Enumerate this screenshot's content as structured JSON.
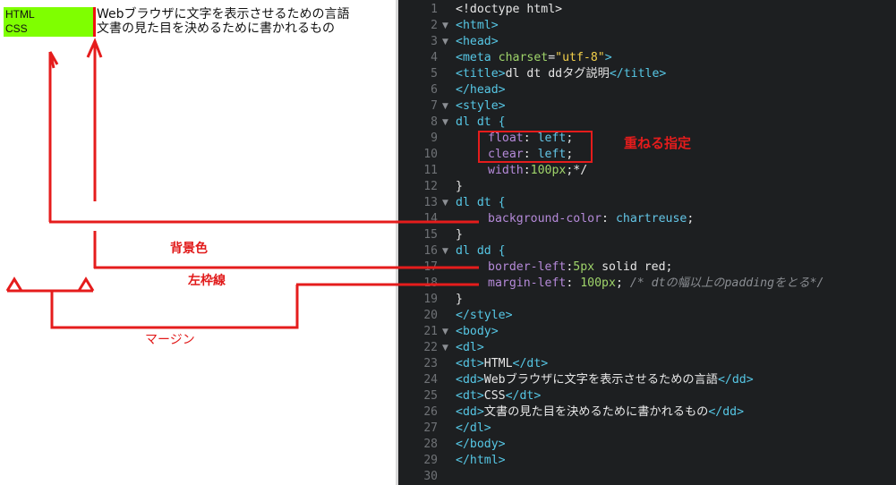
{
  "preview": {
    "rows": [
      {
        "dt": "HTML",
        "dd": "Webブラウザに文字を表示させるための言語"
      },
      {
        "dt": "CSS",
        "dd": "文書の見た目を決めるために書かれるもの"
      }
    ],
    "dt_background": "#7fff00",
    "dd_border_color": "#ff0000"
  },
  "annotations": {
    "background_label": "背景色",
    "border_label": "左枠線",
    "margin_label": "マージン",
    "overlap_label": "重ねる指定",
    "color": "#e51c1c"
  },
  "editor": {
    "lines": [
      {
        "n": "1",
        "fold": ""
      },
      {
        "n": "2",
        "fold": "▼"
      },
      {
        "n": "3",
        "fold": "▼"
      },
      {
        "n": "4",
        "fold": ""
      },
      {
        "n": "5",
        "fold": ""
      },
      {
        "n": "6",
        "fold": ""
      },
      {
        "n": "7",
        "fold": "▼"
      },
      {
        "n": "8",
        "fold": "▼"
      },
      {
        "n": "9",
        "fold": ""
      },
      {
        "n": "10",
        "fold": ""
      },
      {
        "n": "11",
        "fold": ""
      },
      {
        "n": "12",
        "fold": ""
      },
      {
        "n": "13",
        "fold": "▼"
      },
      {
        "n": "14",
        "fold": ""
      },
      {
        "n": "15",
        "fold": ""
      },
      {
        "n": "16",
        "fold": "▼"
      },
      {
        "n": "17",
        "fold": ""
      },
      {
        "n": "18",
        "fold": ""
      },
      {
        "n": "19",
        "fold": ""
      },
      {
        "n": "20",
        "fold": ""
      },
      {
        "n": "21",
        "fold": "▼"
      },
      {
        "n": "22",
        "fold": "▼"
      },
      {
        "n": "23",
        "fold": ""
      },
      {
        "n": "24",
        "fold": ""
      },
      {
        "n": "25",
        "fold": ""
      },
      {
        "n": "26",
        "fold": ""
      },
      {
        "n": "27",
        "fold": ""
      },
      {
        "n": "28",
        "fold": ""
      },
      {
        "n": "29",
        "fold": ""
      },
      {
        "n": "30",
        "fold": ""
      }
    ],
    "code": {
      "l1": "<!doctype html>",
      "l2": "<html>",
      "l3": "<head>",
      "l4_tag": "<meta ",
      "l4_attr": "charset",
      "l4_eq": "=",
      "l4_str": "\"utf-8\"",
      "l4_end": ">",
      "l5_open": "<title>",
      "l5_text": "dl dt ddタグ説明",
      "l5_close": "</title>",
      "l6": "</head>",
      "l7": "<style>",
      "l8": "dl dt {",
      "l9_prop": "float",
      "l9_colon": ": ",
      "l9_val": "left",
      "l9_end": ";",
      "l10_prop": "clear",
      "l10_colon": ": ",
      "l10_val": "left",
      "l10_end": ";",
      "l11_prop": "width",
      "l11_colon": ":",
      "l11_num": "100px",
      "l11_end": ";*/",
      "l12": "}",
      "l13": "dl dt {",
      "l14_prop": "background-color",
      "l14_colon": ": ",
      "l14_val": "chartreuse",
      "l14_end": ";",
      "l15": "}",
      "l16": "dl dd {",
      "l17_prop": "border-left",
      "l17_colon": ":",
      "l17_num": "5px",
      "l17_val": " solid red",
      "l17_end": ";",
      "l18_prop": "margin-left",
      "l18_colon": ": ",
      "l18_num": "100px",
      "l18_end": "; ",
      "l18_cmt": "/* dtの幅以上のpaddingをとる*/",
      "l19": "}",
      "l20": "</style>",
      "l21": "<body>",
      "l22": "<dl>",
      "l23_open": "<dt>",
      "l23_text": "HTML",
      "l23_close": "</dt>",
      "l24_open": "<dd>",
      "l24_text": "Webブラウザに文字を表示させるための言語",
      "l24_close": "</dd>",
      "l25_open": "<dt>",
      "l25_text": "CSS",
      "l25_close": "</dt>",
      "l26_open": "<dd>",
      "l26_text": "文書の見た目を決めるために書かれるもの",
      "l26_close": "</dd>",
      "l27": "</dl>",
      "l28": "</body>",
      "l29": "</html>"
    },
    "colors": {
      "background": "#1d1f21",
      "tag": "#56c7e5",
      "attr": "#9fd46a",
      "string": "#f2cf4a",
      "property": "#b58ad9",
      "value": "#63c5e6",
      "comment": "#8a8d92"
    }
  }
}
